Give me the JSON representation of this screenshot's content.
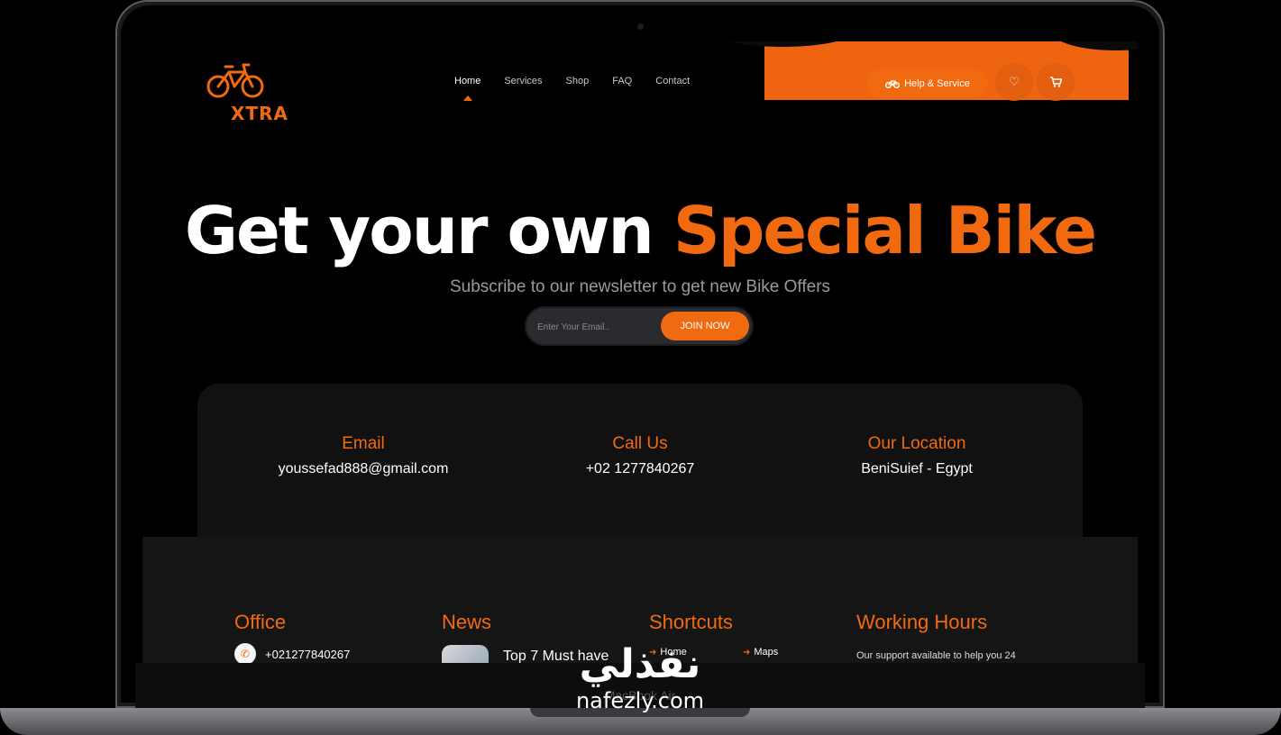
{
  "brand": {
    "name": "XTRA",
    "accent_color": "#f26a10"
  },
  "nav": {
    "items": [
      {
        "label": "Home",
        "active": true
      },
      {
        "label": "Services"
      },
      {
        "label": "Shop"
      },
      {
        "label": "FAQ"
      },
      {
        "label": "Contact"
      }
    ]
  },
  "header": {
    "help_label": "Help & Service",
    "wishlist_icon": "heart-icon",
    "cart_icon": "cart-icon"
  },
  "hero": {
    "title_white": "Get your own",
    "title_accent": "Special Bike",
    "subtitle": "Subscribe to our newsletter to get new Bike Offers",
    "email_placeholder": "Enter Your Email..",
    "join_label": "JOIN NOW"
  },
  "contact": {
    "email": {
      "label": "Email",
      "value": "youssefad888@gmail.com"
    },
    "call": {
      "label": "Call Us",
      "value": "+02 1277840267"
    },
    "location": {
      "label": "Our Location",
      "value": "BeniSuief - Egypt"
    }
  },
  "footer": {
    "office": {
      "heading": "Office",
      "phone": "+021277840267"
    },
    "news": {
      "heading": "News",
      "first_title": "Top 7 Must have"
    },
    "shortcuts": {
      "heading": "Shortcuts",
      "items": [
        "Home",
        "Maps"
      ]
    },
    "hours": {
      "heading": "Working Hours",
      "text": "Our support available to help you 24"
    }
  },
  "device": {
    "model": "MacBook Air"
  },
  "watermark": {
    "arabic": "نفذلي",
    "latin": "nafezly.com"
  }
}
